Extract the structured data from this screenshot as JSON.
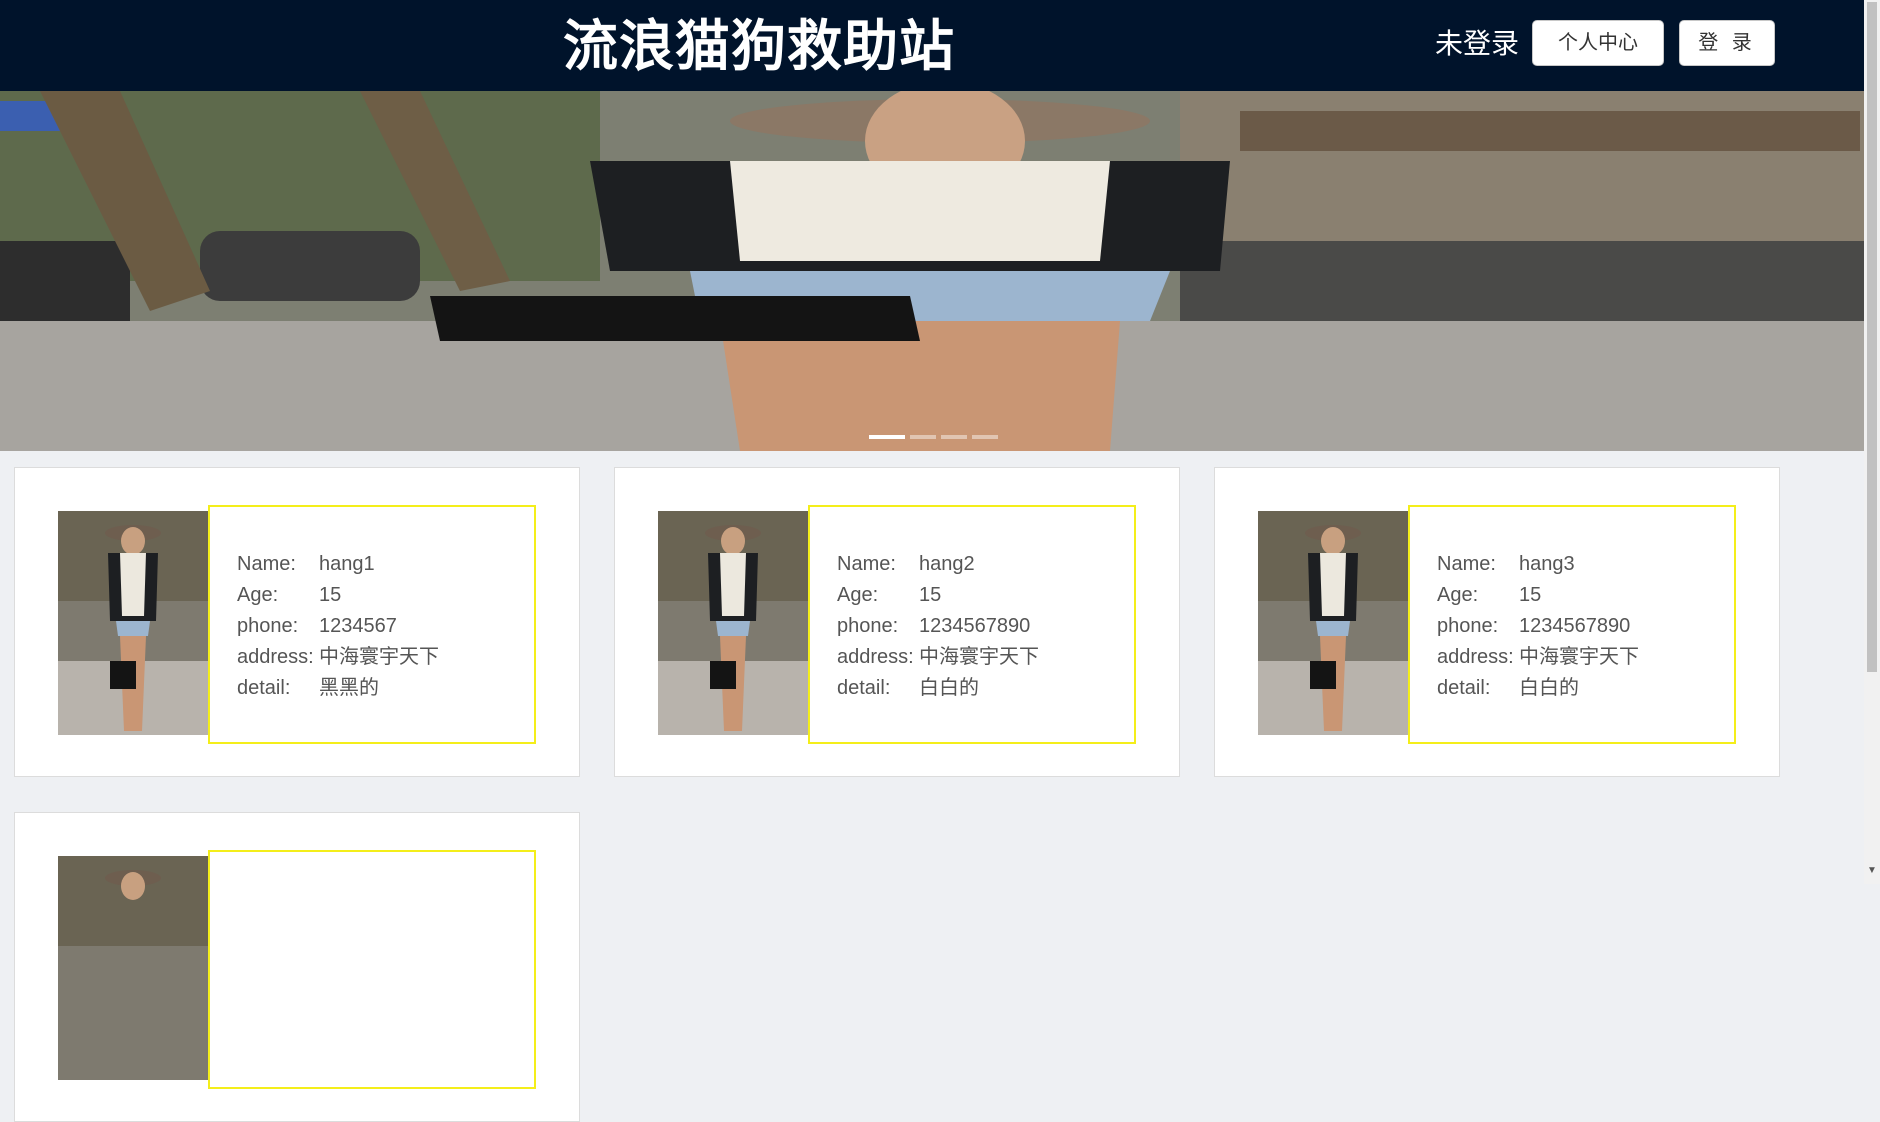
{
  "header": {
    "site_title": "流浪猫狗救助站",
    "login_status": "未登录",
    "personal_center_label": "个人中心",
    "login_label": "登 录"
  },
  "banner": {
    "slide_count": 4,
    "active_slide": 1
  },
  "card_field_labels": {
    "name": "Name:",
    "age": "Age:",
    "phone": "phone:",
    "address": "address:",
    "detail": "detail:"
  },
  "cards": [
    {
      "name": "hang1",
      "age": "15",
      "phone": "1234567",
      "address": "中海寰宇天下",
      "detail": "黑黑的"
    },
    {
      "name": "hang2",
      "age": "15",
      "phone": "1234567890",
      "address": "中海寰宇天下",
      "detail": "白白的"
    },
    {
      "name": "hang3",
      "age": "15",
      "phone": "1234567890",
      "address": "中海寰宇天下",
      "detail": "白白的"
    },
    {
      "name": "",
      "age": "",
      "phone": "",
      "address": "",
      "detail": ""
    }
  ],
  "colors": {
    "header_bg": "#00132b",
    "card_info_border": "#f4ee1a",
    "page_bg": "#eef0f3"
  }
}
